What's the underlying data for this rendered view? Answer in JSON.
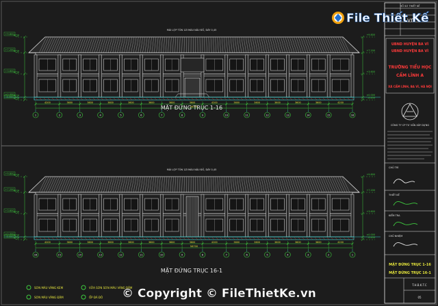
{
  "watermark_top": {
    "brand": "File Thiết Kế",
    "suffix": ".vn"
  },
  "watermark_bottom": "© Copyright © FileThietKe.vn",
  "elevation_top": {
    "title": "MẶT ĐỨNG TRỤC 1-16",
    "top_note": "MÁI LỢP TÔN 1ZI MÀU NÂU ĐỎ, DÀY 0,45",
    "levels": [
      "+9.800",
      "+7.200",
      "+3.600",
      "±0.000",
      "-0.450"
    ],
    "bays": [
      "4200",
      "3600",
      "3600",
      "3600",
      "3600",
      "3600",
      "3600",
      "3600",
      "4200",
      "3600",
      "3600",
      "3600",
      "3600",
      "3600",
      "4200"
    ],
    "total": "56700",
    "axes": [
      "1",
      "2",
      "3",
      "4",
      "5",
      "6",
      "7",
      "8",
      "9",
      "10",
      "11",
      "12",
      "13",
      "14",
      "15",
      "16"
    ]
  },
  "elevation_bottom": {
    "title": "MẶT ĐỨNG TRỤC 16-1",
    "top_note": "MÁI LỢP TÔN 1ZI MÀU NÂU ĐỎ, DÀY 0,45",
    "levels": [
      "+9.800",
      "+7.200",
      "+3.600",
      "±0.000",
      "-0.450"
    ],
    "bays": [
      "4200",
      "3600",
      "3600",
      "3600",
      "3600",
      "3600",
      "3600",
      "3600",
      "4200",
      "3600",
      "3600",
      "3600",
      "3600",
      "3600",
      "4200"
    ],
    "total": "56700",
    "axes": [
      "16",
      "15",
      "14",
      "13",
      "12",
      "11",
      "10",
      "9",
      "8",
      "7",
      "6",
      "5",
      "4",
      "3",
      "2",
      "1"
    ]
  },
  "legend": [
    {
      "text": "SƠN MÀU VÀNG KEM"
    },
    {
      "text": "SƠN MÀU VÀNG ĐẬM"
    },
    {
      "text": "VỮA SƠN SƠN MÀU VÀNG ĐẬM"
    },
    {
      "text": "ỐP ĐÁ ĐỎ"
    }
  ],
  "title_block": {
    "header": "HỒ SƠ THIẾT KẾ",
    "owner_lines": [
      "UBND HUYỆN BA VÌ",
      "UBND HUYỆN BA VÌ",
      "TRƯỜNG TIỂU HỌC",
      "CẨM LĨNH A"
    ],
    "location": "XÃ CẨM LĨNH, BA VÌ, HÀ NỘI",
    "company": "CÔNG TY CP TƯ VẤN XÂY DỰNG",
    "roles": [
      "CHỦ TRÌ",
      "THIẾT KẾ",
      "KIỂM TRA",
      "CHỦ NHIỆM"
    ],
    "drawing_name": [
      "MẶT ĐỨNG TRỤC 1-16",
      "MẶT ĐỨNG TRỤC 16-1"
    ],
    "code": "T.H.B.K.T.C",
    "sheet": "05"
  },
  "colors": {
    "background": "#1c1c1c",
    "line_white": "#e8e8e8",
    "line_cyan": "#3fd0d0",
    "line_green": "#3fce3f",
    "line_yellow": "#e6e63c",
    "line_red": "#ff3a3a",
    "roof": "#d9d9d9"
  }
}
